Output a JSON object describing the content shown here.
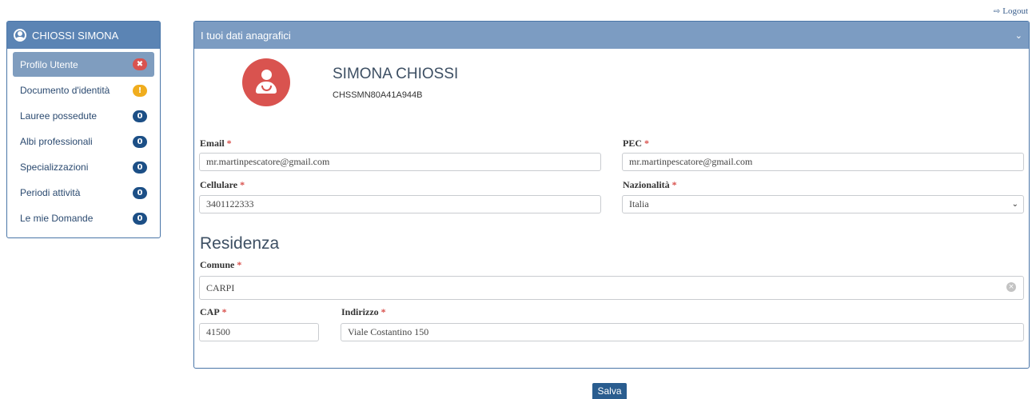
{
  "logout": {
    "label": "Logout",
    "icon": "sign-out-icon"
  },
  "sidebar": {
    "user_name": "CHIOSSI SIMONA",
    "items": [
      {
        "label": "Profilo Utente",
        "badge": "✖",
        "badge_color": "red"
      },
      {
        "label": "Documento d'identità",
        "badge": "!",
        "badge_color": "yellow"
      },
      {
        "label": "Lauree possedute",
        "badge": "0",
        "badge_color": "blue"
      },
      {
        "label": "Albi professionali",
        "badge": "0",
        "badge_color": "blue"
      },
      {
        "label": "Specializzazioni",
        "badge": "0",
        "badge_color": "blue"
      },
      {
        "label": "Periodi attività",
        "badge": "0",
        "badge_color": "blue"
      },
      {
        "label": "Le mie Domande",
        "badge": "0",
        "badge_color": "blue"
      }
    ]
  },
  "panel": {
    "title": "I tuoi dati anagrafici",
    "name": "SIMONA CHIOSSI",
    "codice_fiscale": "CHSSMN80A41A944B",
    "fields": {
      "email": {
        "label": "Email",
        "value": "mr.martinpescatore@gmail.com"
      },
      "pec": {
        "label": "PEC",
        "value": "mr.martinpescatore@gmail.com"
      },
      "cellulare": {
        "label": "Cellulare",
        "value": "3401122333"
      },
      "nazionalita": {
        "label": "Nazionalità",
        "value": "Italia"
      },
      "comune": {
        "label": "Comune",
        "value": "CARPI"
      },
      "cap": {
        "label": "CAP",
        "value": "41500"
      },
      "indirizzo": {
        "label": "Indirizzo",
        "value": "Viale Costantino 150"
      }
    },
    "residenza_title": "Residenza",
    "required_mark": "*"
  },
  "save_label": "Salva",
  "colors": {
    "header": "#5b84b4",
    "accent": "#1c4f86",
    "required": "#d9534f",
    "avatar": "#d9534f"
  }
}
